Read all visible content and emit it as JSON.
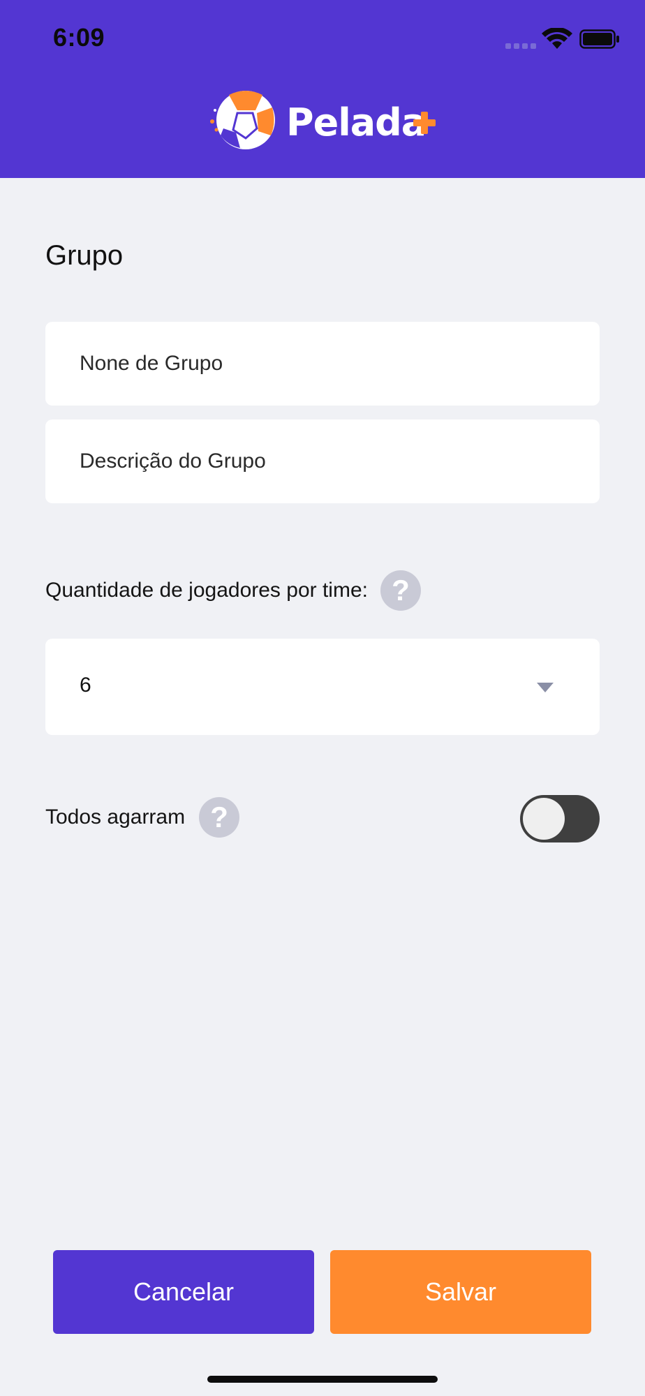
{
  "status_bar": {
    "time": "6:09"
  },
  "header": {
    "app_name": "Pelada",
    "logo_icon": "soccer-ball-icon",
    "plus_icon": "plus-icon",
    "brand_color": "#5336d2",
    "accent_color": "#ff8a2e"
  },
  "form": {
    "section_title": "Grupo",
    "name_field": {
      "placeholder": "None de Grupo",
      "value": ""
    },
    "description_field": {
      "placeholder": "Descrição do Grupo",
      "value": ""
    },
    "players_label": "Quantidade de jogadores por time:",
    "players_help_icon": "question-icon",
    "help_glyph": "?",
    "players_select": {
      "value": "6",
      "icon": "dropdown-arrow-icon"
    },
    "keepers_label": "Todos agarram",
    "keepers_help_icon": "question-icon",
    "keepers_toggle": {
      "on": false
    }
  },
  "footer": {
    "cancel_label": "Cancelar",
    "save_label": "Salvar"
  }
}
